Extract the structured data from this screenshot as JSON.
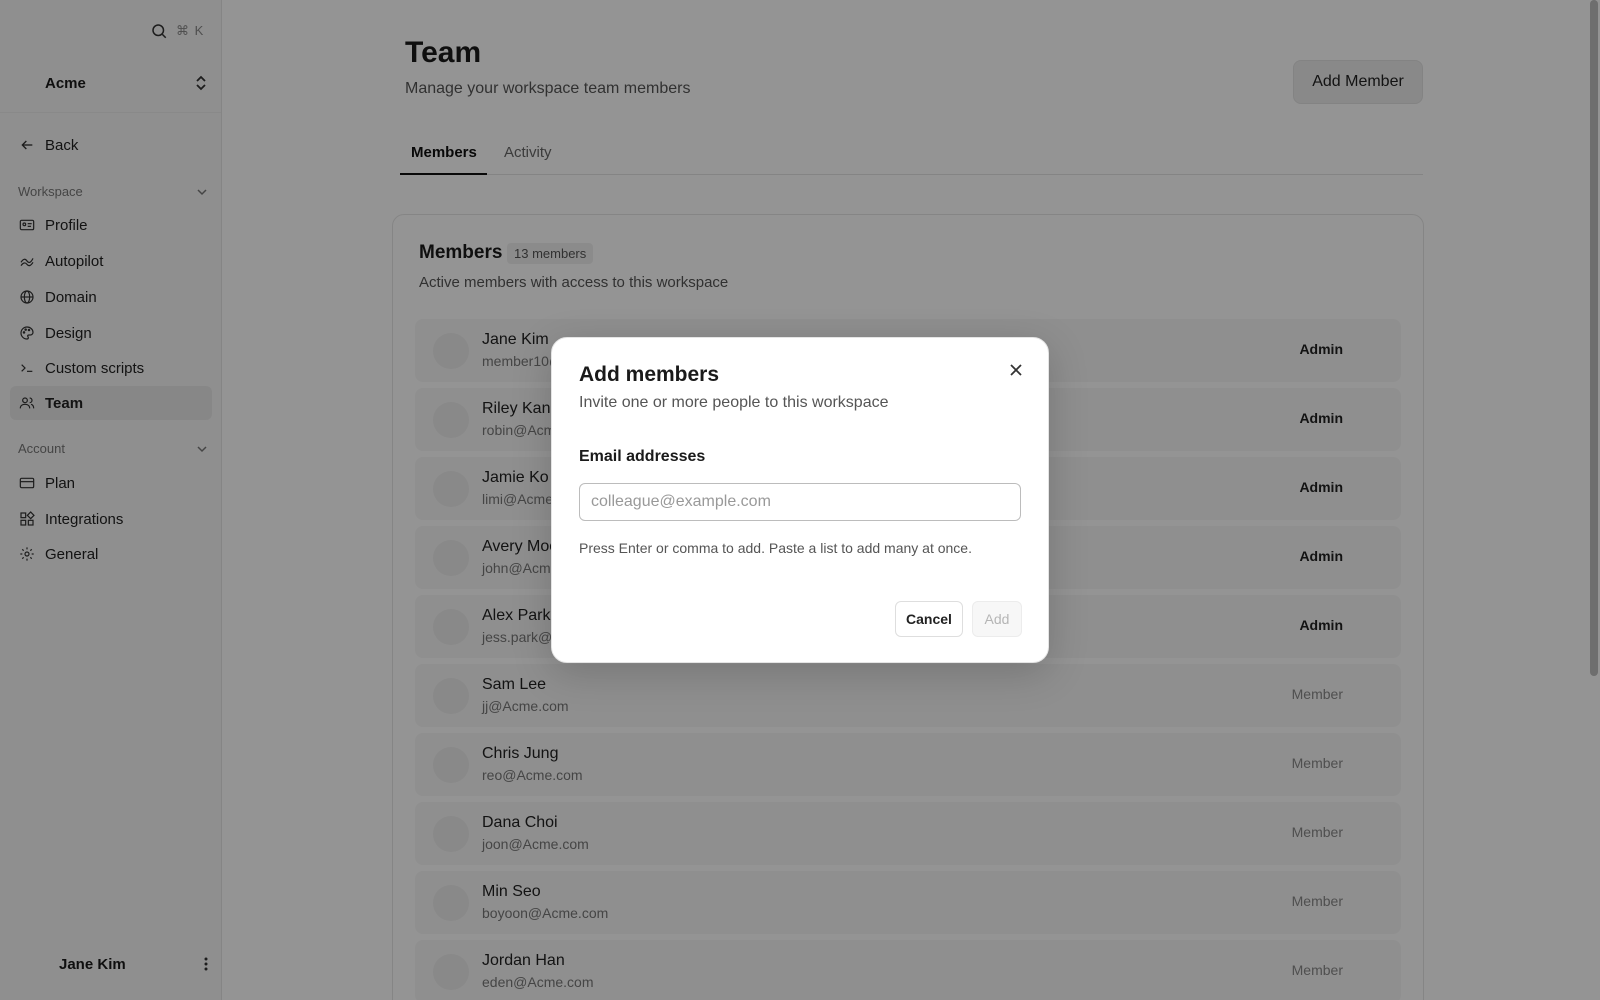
{
  "sidebar": {
    "search_shortcut": "⌘ K",
    "workspace_name": "Acme",
    "back_label": "Back",
    "sections": {
      "workspace": "Workspace",
      "account": "Account"
    },
    "workspace_items": [
      {
        "label": "Profile",
        "icon": "id-card-icon"
      },
      {
        "label": "Autopilot",
        "icon": "autopilot-icon"
      },
      {
        "label": "Domain",
        "icon": "globe-icon"
      },
      {
        "label": "Design",
        "icon": "palette-icon"
      },
      {
        "label": "Custom scripts",
        "icon": "terminal-icon"
      },
      {
        "label": "Team",
        "icon": "users-icon",
        "active": true
      }
    ],
    "account_items": [
      {
        "label": "Plan",
        "icon": "credit-card-icon"
      },
      {
        "label": "Integrations",
        "icon": "integrations-icon"
      },
      {
        "label": "General",
        "icon": "gear-icon"
      }
    ],
    "user_name": "Jane Kim"
  },
  "header": {
    "title": "Team",
    "subtitle": "Manage your workspace team members",
    "add_member_label": "Add Member"
  },
  "tabs": [
    {
      "label": "Members",
      "active": true
    },
    {
      "label": "Activity",
      "active": false
    }
  ],
  "members_card": {
    "title": "Members",
    "count_badge": "13 members",
    "description": "Active members with access to this workspace",
    "members": [
      {
        "name": "Jane Kim",
        "email": "member10@",
        "role": "Admin"
      },
      {
        "name": "Riley Kang",
        "email": "robin@Acm",
        "role": "Admin"
      },
      {
        "name": "Jamie Ko",
        "email": "limi@Acme",
        "role": "Admin"
      },
      {
        "name": "Avery Moo",
        "email": "john@Acme",
        "role": "Admin"
      },
      {
        "name": "Alex Park",
        "email": "jess.park@",
        "role": "Admin"
      },
      {
        "name": "Sam Lee",
        "email": "jj@Acme.com",
        "role": "Member"
      },
      {
        "name": "Chris Jung",
        "email": "reo@Acme.com",
        "role": "Member"
      },
      {
        "name": "Dana Choi",
        "email": "joon@Acme.com",
        "role": "Member"
      },
      {
        "name": "Min Seo",
        "email": "boyoon@Acme.com",
        "role": "Member"
      },
      {
        "name": "Jordan Han",
        "email": "eden@Acme.com",
        "role": "Member"
      }
    ]
  },
  "modal": {
    "title": "Add members",
    "subtitle": "Invite one or more people to this workspace",
    "field_label": "Email addresses",
    "input_value": "",
    "input_placeholder": "colleague@example.com",
    "hint": "Press Enter or comma to add. Paste a list to add many at once.",
    "cancel_label": "Cancel",
    "add_label": "Add"
  }
}
